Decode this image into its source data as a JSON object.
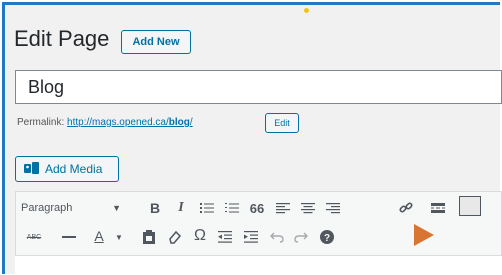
{
  "header": {
    "title": "Edit Page",
    "add_new_label": "Add New"
  },
  "post": {
    "title_value": "Blog"
  },
  "permalink": {
    "label": "Permalink:",
    "url_prefix": "http://mags.opened.ca/",
    "slug": "blog",
    "url_suffix": "/",
    "edit_label": "Edit"
  },
  "media": {
    "add_media_label": "Add Media"
  },
  "toolbar": {
    "format_select_value": "Paragraph",
    "row1_icons": [
      "bold-icon",
      "italic-icon",
      "bulleted-list-icon",
      "numbered-list-icon",
      "blockquote-icon",
      "align-left-icon",
      "align-center-icon",
      "align-right-icon",
      "link-icon",
      "read-more-icon",
      "toolbar-toggle-icon"
    ],
    "row2_icons": [
      "strikethrough-icon",
      "horizontal-line-icon",
      "text-color-icon",
      "paste-as-text-icon",
      "clear-formatting-icon",
      "special-character-icon",
      "outdent-icon",
      "indent-icon",
      "undo-icon",
      "redo-icon",
      "help-icon"
    ],
    "bold_glyph": "B",
    "italic_glyph": "I",
    "text_color_glyph": "A",
    "strike_glyph": "ABC",
    "omega_glyph": "Ω",
    "quote_glyph": "66"
  },
  "colors": {
    "accent": "#0071a1",
    "frame": "#1e7ac8",
    "cursor_marker": "#d87532"
  }
}
